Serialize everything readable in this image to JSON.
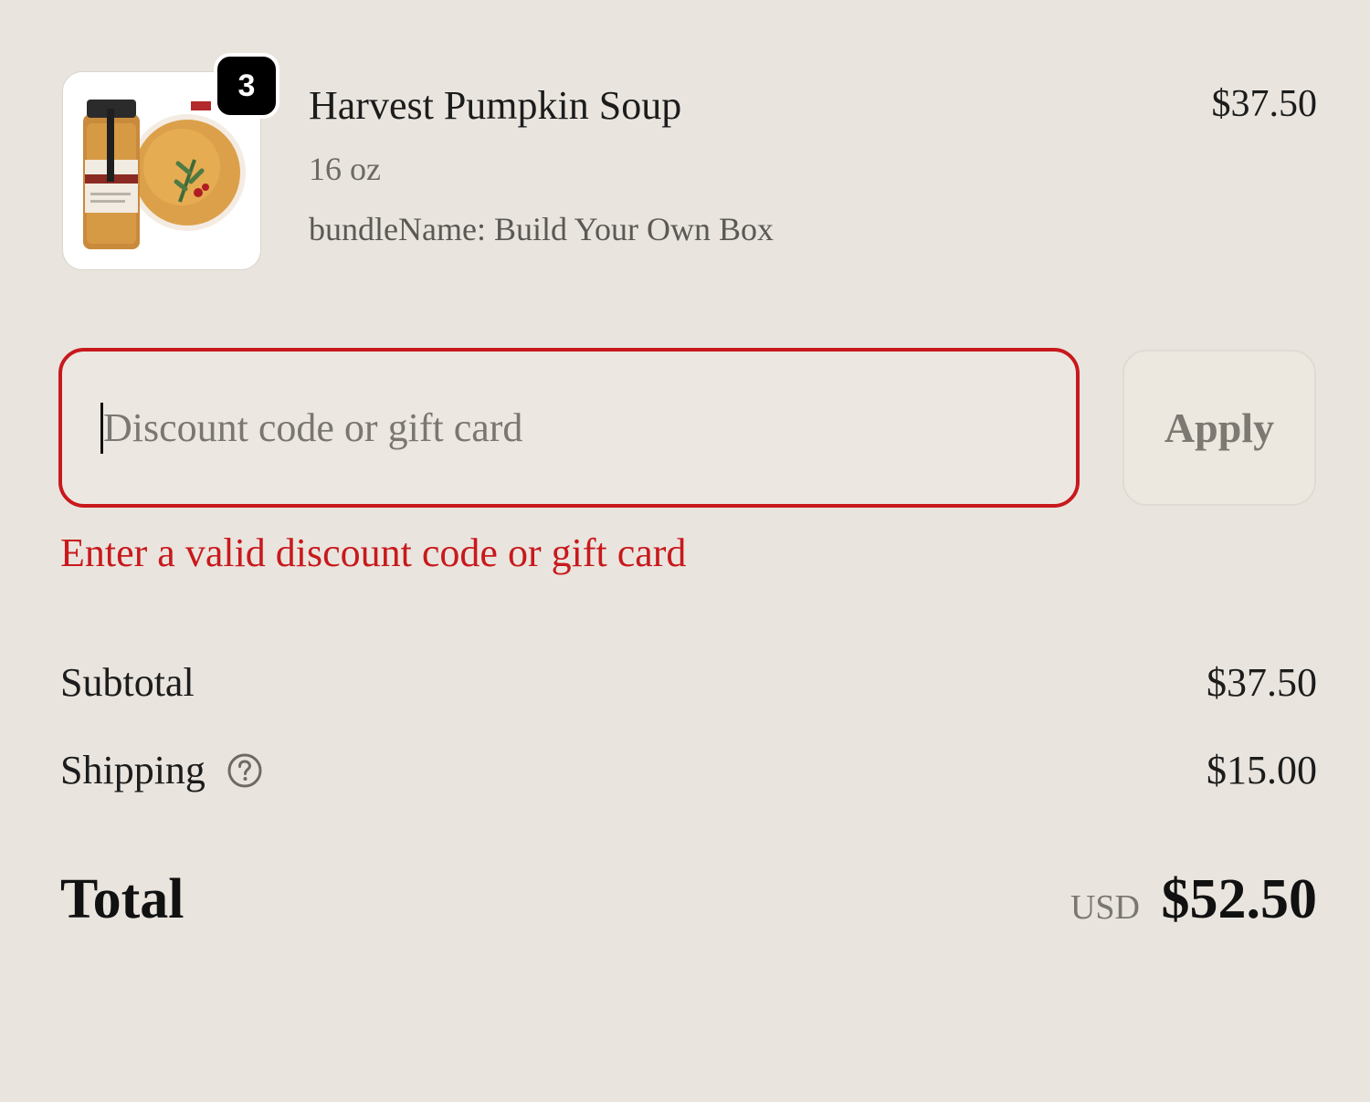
{
  "line_item": {
    "quantity": "3",
    "title": "Harvest Pumpkin Soup",
    "variant": "16 oz",
    "property": "bundleName: Build Your Own Box",
    "price": "$37.50",
    "image_icon": "soup-jar-product-image"
  },
  "discount": {
    "placeholder": "Discount code or gift card",
    "value": "",
    "apply_label": "Apply",
    "error": "Enter a valid discount code or gift card"
  },
  "summary": {
    "subtotal_label": "Subtotal",
    "subtotal_value": "$37.50",
    "shipping_label": "Shipping",
    "shipping_value": "$15.00",
    "shipping_help_icon": "question-circle-icon",
    "total_label": "Total",
    "total_currency": "USD",
    "total_value": "$52.50"
  },
  "colors": {
    "background": "#e9e5de",
    "error": "#c8191d",
    "badge": "#000000"
  }
}
